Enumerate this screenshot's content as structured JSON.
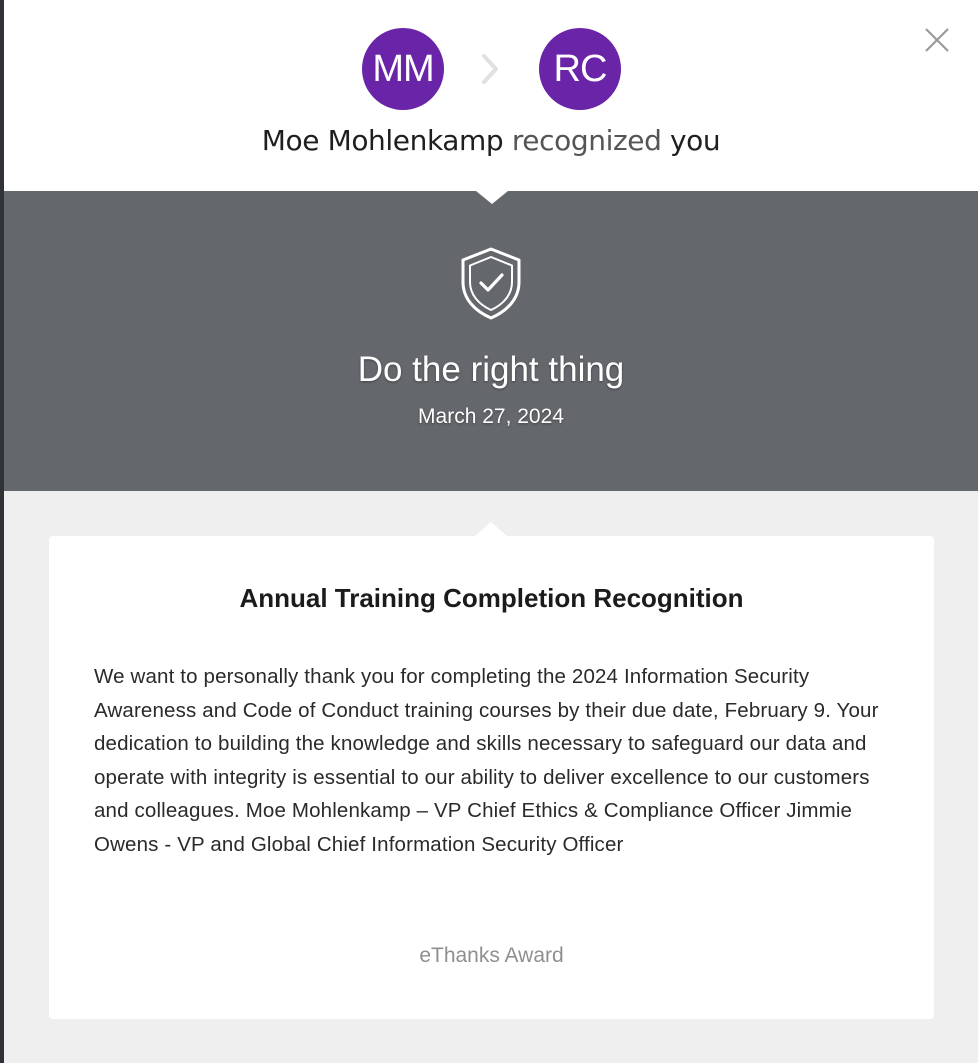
{
  "header": {
    "sender_initials": "MM",
    "recipient_initials": "RC",
    "sender_name": "Moe Mohlenkamp",
    "action_text": "recognized",
    "recipient_text": "you",
    "avatar_color": "#6a24a8",
    "close_icon": "close-icon",
    "arrow_icon": "chevron-right-icon"
  },
  "banner": {
    "icon": "shield-check-icon",
    "value_title": "Do the right thing",
    "date": "March 27, 2024",
    "background_color": "#64676b"
  },
  "card": {
    "title": "Annual Training Completion Recognition",
    "message": "We want to personally thank you for completing the 2024 Information Security Awareness and Code of Conduct training courses by their due date, February 9. Your dedication to building the knowledge and skills necessary to safeguard our data and operate with integrity is essential to our ability to deliver excellence to our customers and colleagues. Moe Mohlenkamp – VP Chief Ethics & Compliance Officer Jimmie Owens - VP and Global Chief Information Security Officer",
    "award_type": "eThanks Award"
  }
}
